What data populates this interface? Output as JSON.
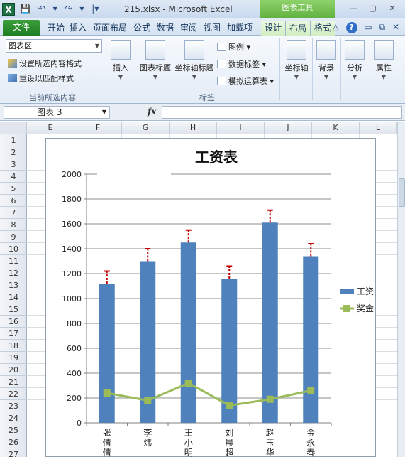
{
  "window": {
    "logo": "X",
    "title": "215.xlsx - Microsoft Excel",
    "tool_context": "图表工具",
    "qat": [
      "💾",
      "↶",
      "▾",
      "↷",
      "▾",
      "|▾"
    ],
    "controls": [
      "—",
      "▢",
      "✕"
    ]
  },
  "tabs": {
    "file": "文件",
    "items": [
      "开始",
      "插入",
      "页面布局",
      "公式",
      "数据",
      "审阅",
      "视图",
      "加载项"
    ],
    "tool_items": [
      "设计",
      "布局",
      "格式"
    ],
    "active": "布局",
    "right_icons": [
      "△",
      "?",
      "▭",
      "⧉",
      "✕"
    ]
  },
  "ribbon": {
    "selection_combo": "图表区",
    "format_selection": "设置所选内容格式",
    "reset_style": "重设以匹配样式",
    "group_current": "当前所选内容",
    "insert": "插入",
    "chart_title": "图表标题",
    "axis_titles": "坐标轴标题",
    "legend": "图例",
    "data_labels": "数据标签",
    "data_table": "模拟运算表",
    "group_labels": "标签",
    "axes": "坐标轴",
    "background": "背景",
    "analysis": "分析",
    "properties": "属性"
  },
  "formula_bar": {
    "name_box": "图表 3",
    "fx": "fx",
    "value": ""
  },
  "grid": {
    "columns": [
      "E",
      "F",
      "G",
      "H",
      "I",
      "J",
      "K",
      "L"
    ],
    "rows": [
      "1",
      "2",
      "3",
      "4",
      "5",
      "6",
      "7",
      "8",
      "9",
      "10",
      "11",
      "12",
      "13",
      "14",
      "15",
      "16",
      "17",
      "18",
      "19",
      "20",
      "21",
      "22",
      "23",
      "24",
      "25",
      "26",
      "27"
    ]
  },
  "chart_data": {
    "type": "bar",
    "title": "工资表",
    "categories": [
      "张倩倩",
      "李炜",
      "王小明",
      "刘晨超",
      "赵玉华",
      "金永春"
    ],
    "series": [
      {
        "name": "工资",
        "type": "bar",
        "values": [
          1120,
          1300,
          1450,
          1160,
          1610,
          1340
        ],
        "error_plus": 100,
        "color": "#4f81bd",
        "error_color": "#c00000"
      },
      {
        "name": "奖金",
        "type": "line",
        "values": [
          240,
          180,
          320,
          140,
          190,
          260
        ],
        "color": "#9bbb59"
      }
    ],
    "ylim": [
      0,
      2000
    ],
    "yticks": [
      0,
      200,
      400,
      600,
      800,
      1000,
      1200,
      1400,
      1600,
      1800,
      2000
    ],
    "grid": true,
    "legend": "right"
  }
}
